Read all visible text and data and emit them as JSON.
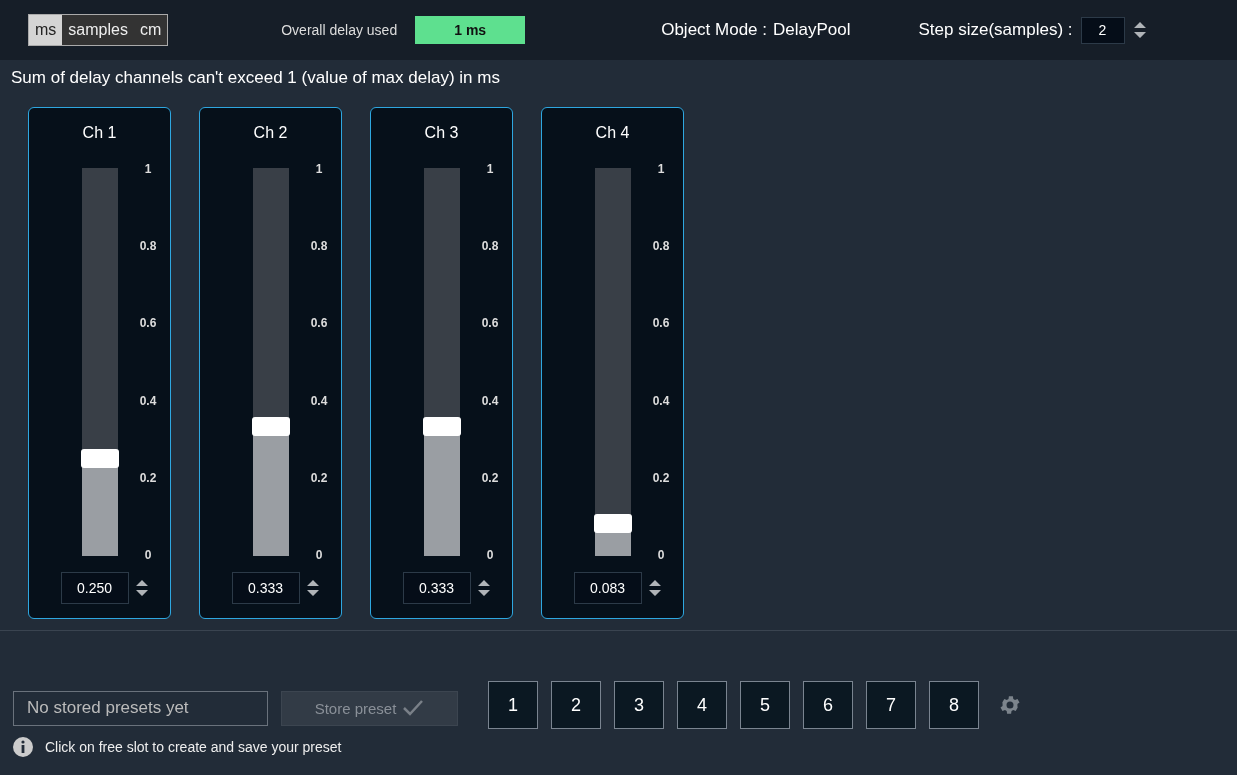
{
  "units": [
    {
      "label": "ms",
      "selected": true
    },
    {
      "label": "samples",
      "selected": false
    },
    {
      "label": "cm",
      "selected": false
    }
  ],
  "overall": {
    "label": "Overall delay used",
    "value": "1 ms"
  },
  "object_mode": {
    "label": "Object Mode :",
    "value": "DelayPool"
  },
  "step_size": {
    "label": "Step size(samples) :",
    "value": "2"
  },
  "message": "Sum of delay channels can't exceed 1 (value of max delay) in ms",
  "channels": [
    {
      "name": "Ch 1",
      "level": 0.25,
      "value": "0.250",
      "scale": [
        "1",
        "0.8",
        "0.6",
        "0.4",
        "0.2",
        "0"
      ]
    },
    {
      "name": "Ch 2",
      "level": 0.333,
      "value": "0.333",
      "scale": [
        "1",
        "0.8",
        "0.6",
        "0.4",
        "0.2",
        "0"
      ]
    },
    {
      "name": "Ch 3",
      "level": 0.333,
      "value": "0.333",
      "scale": [
        "1",
        "0.8",
        "0.6",
        "0.4",
        "0.2",
        "0"
      ]
    },
    {
      "name": "Ch 4",
      "level": 0.083,
      "value": "0.083",
      "scale": [
        "1",
        "0.8",
        "0.6",
        "0.4",
        "0.2",
        "0"
      ]
    }
  ],
  "presets": {
    "placeholder": "No stored presets yet",
    "store_button": {
      "label": "Store preset",
      "disabled": true
    },
    "hint": "Click on free slot to create and save your preset",
    "slots": [
      "1",
      "2",
      "3",
      "4",
      "5",
      "6",
      "7",
      "8"
    ]
  }
}
